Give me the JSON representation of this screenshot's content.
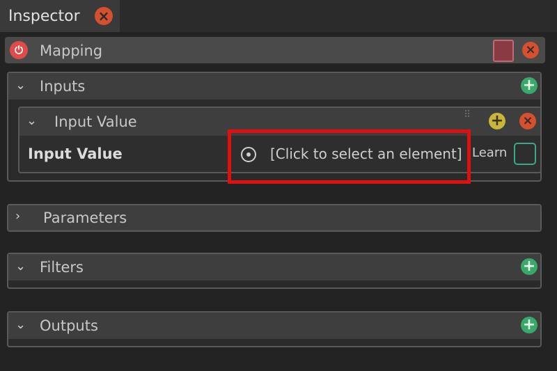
{
  "tab": {
    "title": "Inspector",
    "close_icon": "close-icon"
  },
  "header": {
    "title": "Mapping",
    "power_icon": "power-icon",
    "swatch_color": "#8a3a42"
  },
  "inputs": {
    "title": "Inputs",
    "input_value": {
      "title": "Input Value",
      "field_label": "Input Value",
      "field_value": "[Click to select an element]",
      "learn_label": "Learn"
    }
  },
  "parameters": {
    "title": "Parameters"
  },
  "filters": {
    "title": "Filters"
  },
  "outputs": {
    "title": "Outputs"
  },
  "colors": {
    "accent_green": "#3aa86a",
    "close_red": "#d4502e",
    "highlight_red": "#e01010"
  }
}
